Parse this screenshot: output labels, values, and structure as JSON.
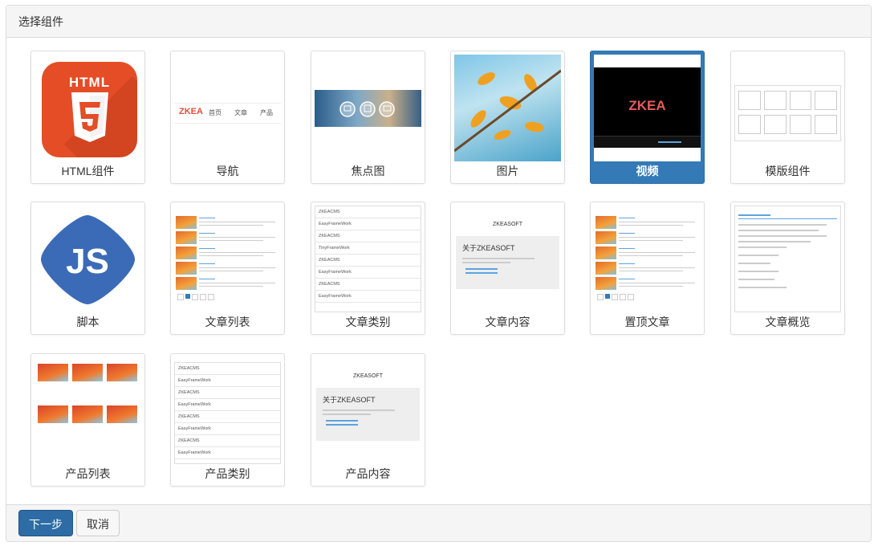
{
  "panel": {
    "title": "选择组件"
  },
  "components": [
    {
      "label": "HTML组件",
      "icon": "html5-icon"
    },
    {
      "label": "导航",
      "icon": "navigation-preview"
    },
    {
      "label": "焦点图",
      "icon": "carousel-preview"
    },
    {
      "label": "图片",
      "icon": "image-preview"
    },
    {
      "label": "视频",
      "icon": "video-preview",
      "selected": true
    },
    {
      "label": "模版组件",
      "icon": "template-preview"
    },
    {
      "label": "脚本",
      "icon": "javascript-icon"
    },
    {
      "label": "文章列表",
      "icon": "article-list-preview"
    },
    {
      "label": "文章类别",
      "icon": "article-category-preview"
    },
    {
      "label": "文章内容",
      "icon": "article-content-preview"
    },
    {
      "label": "置顶文章",
      "icon": "top-article-preview"
    },
    {
      "label": "文章概览",
      "icon": "article-summary-preview"
    },
    {
      "label": "产品列表",
      "icon": "product-list-preview"
    },
    {
      "label": "产品类别",
      "icon": "product-category-preview"
    },
    {
      "label": "产品内容",
      "icon": "product-content-preview"
    }
  ],
  "previews": {
    "html5_text": "HTML",
    "js_text": "JS",
    "nav": {
      "logo": "ZKEA",
      "items": [
        "首页",
        "文章",
        "产品"
      ]
    },
    "video_logo": "ZKEA",
    "category_items": [
      "ZKEACMS",
      "EasyFrameWork",
      "ZKEACMS",
      "TinyFrameWork",
      "ZKEACMS",
      "EasyFrameWork",
      "ZKEACMS",
      "EasyFrameWork"
    ],
    "product_category_items": [
      "ZKEACMS",
      "EasyFrameWork",
      "ZKEACMS",
      "EasyFrameWork",
      "ZKEACMS",
      "EasyFrameWork",
      "ZKEACMS",
      "EasyFrameWork"
    ],
    "about_brand": "ZKEASOFT",
    "about_title": "关于ZKEASOFT"
  },
  "footer": {
    "next_label": "下一步",
    "cancel_label": "取消"
  },
  "colors": {
    "primary": "#2d6ca5",
    "selected": "#337ab7",
    "html5": "#e44d26",
    "js": "#3b6bb7"
  }
}
